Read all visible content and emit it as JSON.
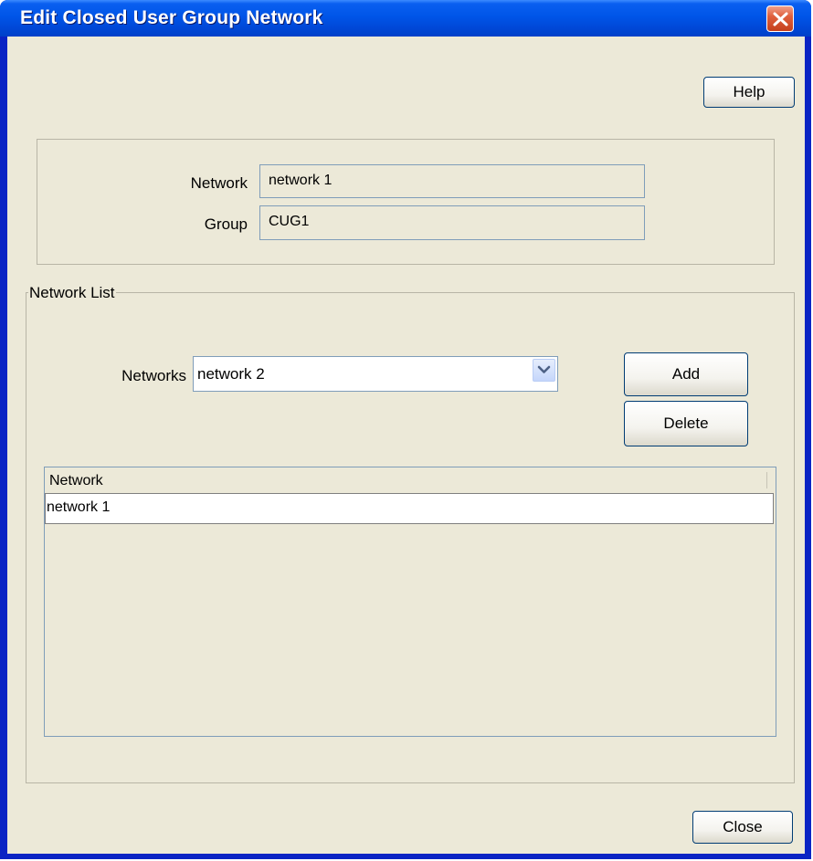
{
  "window": {
    "title": "Edit Closed User Group Network"
  },
  "toolbar": {
    "help_label": "Help"
  },
  "details": {
    "network_label": "Network",
    "network_value": "network 1",
    "group_label": "Group",
    "group_value": "CUG1"
  },
  "network_list": {
    "legend": "Network List",
    "networks_label": "Networks",
    "networks_selected": "network 2",
    "add_label": "Add",
    "delete_label": "Delete",
    "table": {
      "columns": [
        "Network"
      ],
      "rows": [
        [
          "network 1"
        ]
      ]
    }
  },
  "footer": {
    "close_label": "Close"
  },
  "icons": {
    "close": "close-icon",
    "dropdown": "chevron-down-icon"
  }
}
